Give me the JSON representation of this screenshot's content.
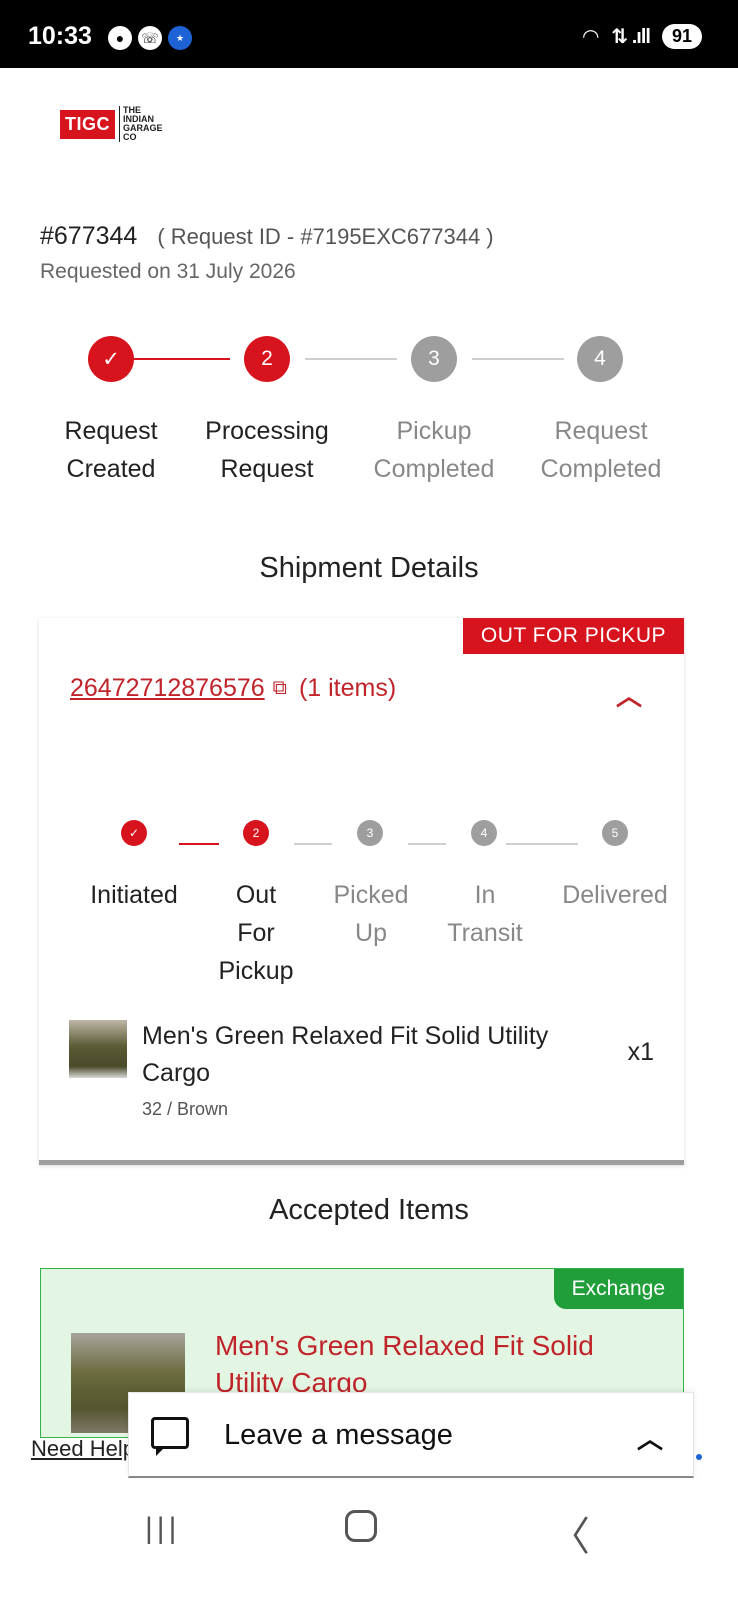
{
  "status_bar": {
    "time": "10:33",
    "notification_icons": [
      "chat-bubble-icon",
      "whatsapp-icon",
      "app-badge-icon"
    ],
    "signal_text": "⇅ .ıll",
    "battery": "91"
  },
  "brand": {
    "logo_text": "TIGC",
    "logo_sub": "THE INDIAN GARAGE CO",
    "brand_color": "#d7141d"
  },
  "request": {
    "order_number": "#677344",
    "request_id": "( Request ID - #7195EXC677344 )",
    "requested_on": "Requested on 31 July 2026"
  },
  "request_steps": [
    {
      "label_1": "Request",
      "label_2": "Created",
      "number": "✓",
      "state": "done"
    },
    {
      "label_1": "Processing",
      "label_2": "Request",
      "number": "2",
      "state": "current"
    },
    {
      "label_1": "Pickup",
      "label_2": "Completed",
      "number": "3",
      "state": "pending"
    },
    {
      "label_1": "Request",
      "label_2": "Completed",
      "number": "4",
      "state": "pending"
    }
  ],
  "shipment": {
    "section_title": "Shipment Details",
    "status_label": "OUT FOR PICKUP",
    "tracking_number": "26472712876576",
    "items_count": "(1 items)",
    "steps": [
      {
        "lines": [
          "Initiated"
        ],
        "number": "✓",
        "state": "done"
      },
      {
        "lines": [
          "Out",
          "For",
          "Pickup"
        ],
        "number": "2",
        "state": "current"
      },
      {
        "lines": [
          "Picked",
          "Up"
        ],
        "number": "3",
        "state": "pending"
      },
      {
        "lines": [
          "In",
          "Transit"
        ],
        "number": "4",
        "state": "pending"
      },
      {
        "lines": [
          "Delivered"
        ],
        "number": "5",
        "state": "pending"
      }
    ],
    "item": {
      "name": "Men's Green Relaxed Fit Solid Utility Cargo",
      "variant": "32 / Brown",
      "quantity": "x1"
    }
  },
  "accepted": {
    "section_title": "Accepted Items",
    "badge": "Exchange",
    "item_name": "Men's Green Relaxed Fit Solid Utility Cargo",
    "accent_color": "#1f9e3a"
  },
  "help": {
    "need_help": "Need Help?",
    "chat_label": "Leave a message"
  }
}
